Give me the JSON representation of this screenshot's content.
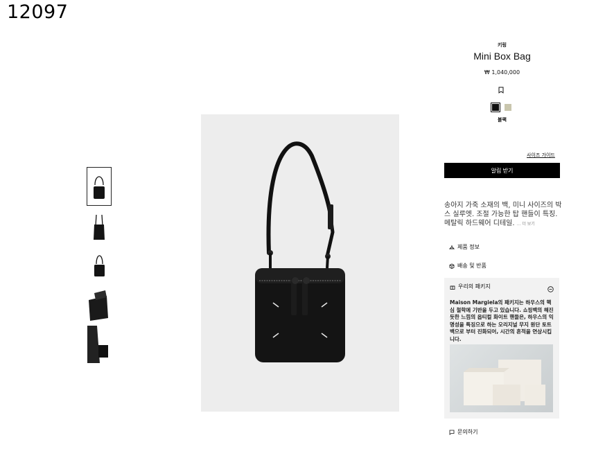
{
  "page_id": "12097",
  "product": {
    "category": "키링",
    "title": "Mini Box Bag",
    "price": "₩ 1,040,000",
    "selected_color": "블랙",
    "colors": [
      "#111111",
      "#c9c6ad"
    ]
  },
  "links": {
    "size_guide": "사이즈 가이드",
    "notify": "알림 받기",
    "product_info": "제품 정보",
    "shipping": "배송 및 반품",
    "inquiry": "문의하기"
  },
  "description": {
    "text": "송아지 가죽 소재의 백, 미니 사이즈의 박스 실루엣. 조절 가능한 탑 핸들이 특징. 메탈릭 하드웨어 디테일.",
    "more": "... 더 보기"
  },
  "package": {
    "title": "우리의 패키지",
    "text": "Maison Margiela의 패키지는 하우스의 핵심 철학에 기반을 두고 있습니다. 쇼핑백의 해진 듯한 느낌의 옵티컬 화이트 핸들은, 하우스의 익명성을 특징으로 하는 오리지널 무지 원단 토트 백으로 부터 진화되어, 시간의 흔적을 연상시킵니다."
  }
}
